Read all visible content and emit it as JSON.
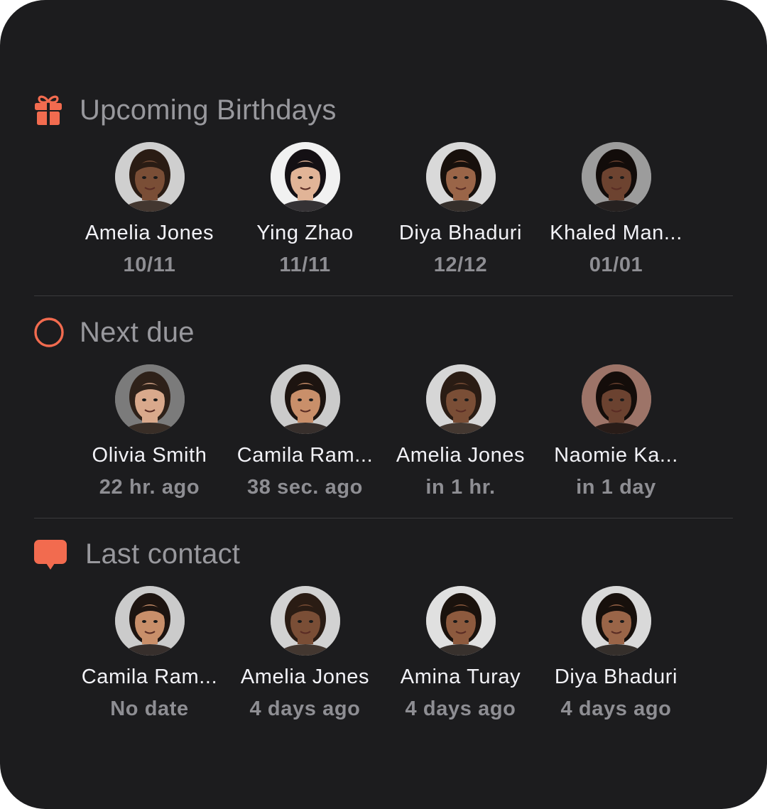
{
  "colors": {
    "accent": "#f26b4f",
    "background": "#1c1c1e",
    "secondary_text": "#8e8e93",
    "primary_text": "#f2f2f7"
  },
  "sections": [
    {
      "title": "Upcoming Birthdays",
      "icon": "gift-icon",
      "people": [
        {
          "name": "Amelia Jones",
          "sub": "10/11",
          "skin": "#7a4e36",
          "hair": "#2a1c14",
          "bg": "#cfcfcf"
        },
        {
          "name": "Ying Zhao",
          "sub": "11/11",
          "skin": "#e1b497",
          "hair": "#141014",
          "bg": "#f1f1f1"
        },
        {
          "name": "Diya Bhaduri",
          "sub": "12/12",
          "skin": "#9a6548",
          "hair": "#17100c",
          "bg": "#d9d9d9"
        },
        {
          "name": "Khaled Man...",
          "sub": "01/01",
          "skin": "#6d4330",
          "hair": "#120c0a",
          "bg": "#9c9c9c"
        }
      ]
    },
    {
      "title": "Next due",
      "icon": "circle-icon",
      "people": [
        {
          "name": "Olivia Smith",
          "sub": "22 hr. ago",
          "skin": "#d9a98c",
          "hair": "#2e2119",
          "bg": "#7b7b7b"
        },
        {
          "name": "Camila Ram...",
          "sub": "38 sec. ago",
          "skin": "#c98f6a",
          "hair": "#1d1410",
          "bg": "#cbcbcb"
        },
        {
          "name": "Amelia Jones",
          "sub": "in 1 hr.",
          "skin": "#7a4e36",
          "hair": "#2a1c14",
          "bg": "#d6d6d6"
        },
        {
          "name": "Naomie Ka...",
          "sub": "in 1 day",
          "skin": "#6b4230",
          "hair": "#140d0a",
          "bg": "#9d7468"
        }
      ]
    },
    {
      "title": "Last contact",
      "icon": "chat-bubble-icon",
      "people": [
        {
          "name": "Camila Ram...",
          "sub": "No date",
          "skin": "#c98f6a",
          "hair": "#1d1410",
          "bg": "#cbcbcb"
        },
        {
          "name": "Amelia Jones",
          "sub": "4 days ago",
          "skin": "#7a4e36",
          "hair": "#2a1c14",
          "bg": "#d2d2d2"
        },
        {
          "name": "Amina Turay",
          "sub": "4 days ago",
          "skin": "#8d5a3e",
          "hair": "#1a120d",
          "bg": "#e0e0e0"
        },
        {
          "name": "Diya Bhaduri",
          "sub": "4 days ago",
          "skin": "#9a6548",
          "hair": "#17100c",
          "bg": "#d9d9d9"
        }
      ]
    }
  ]
}
